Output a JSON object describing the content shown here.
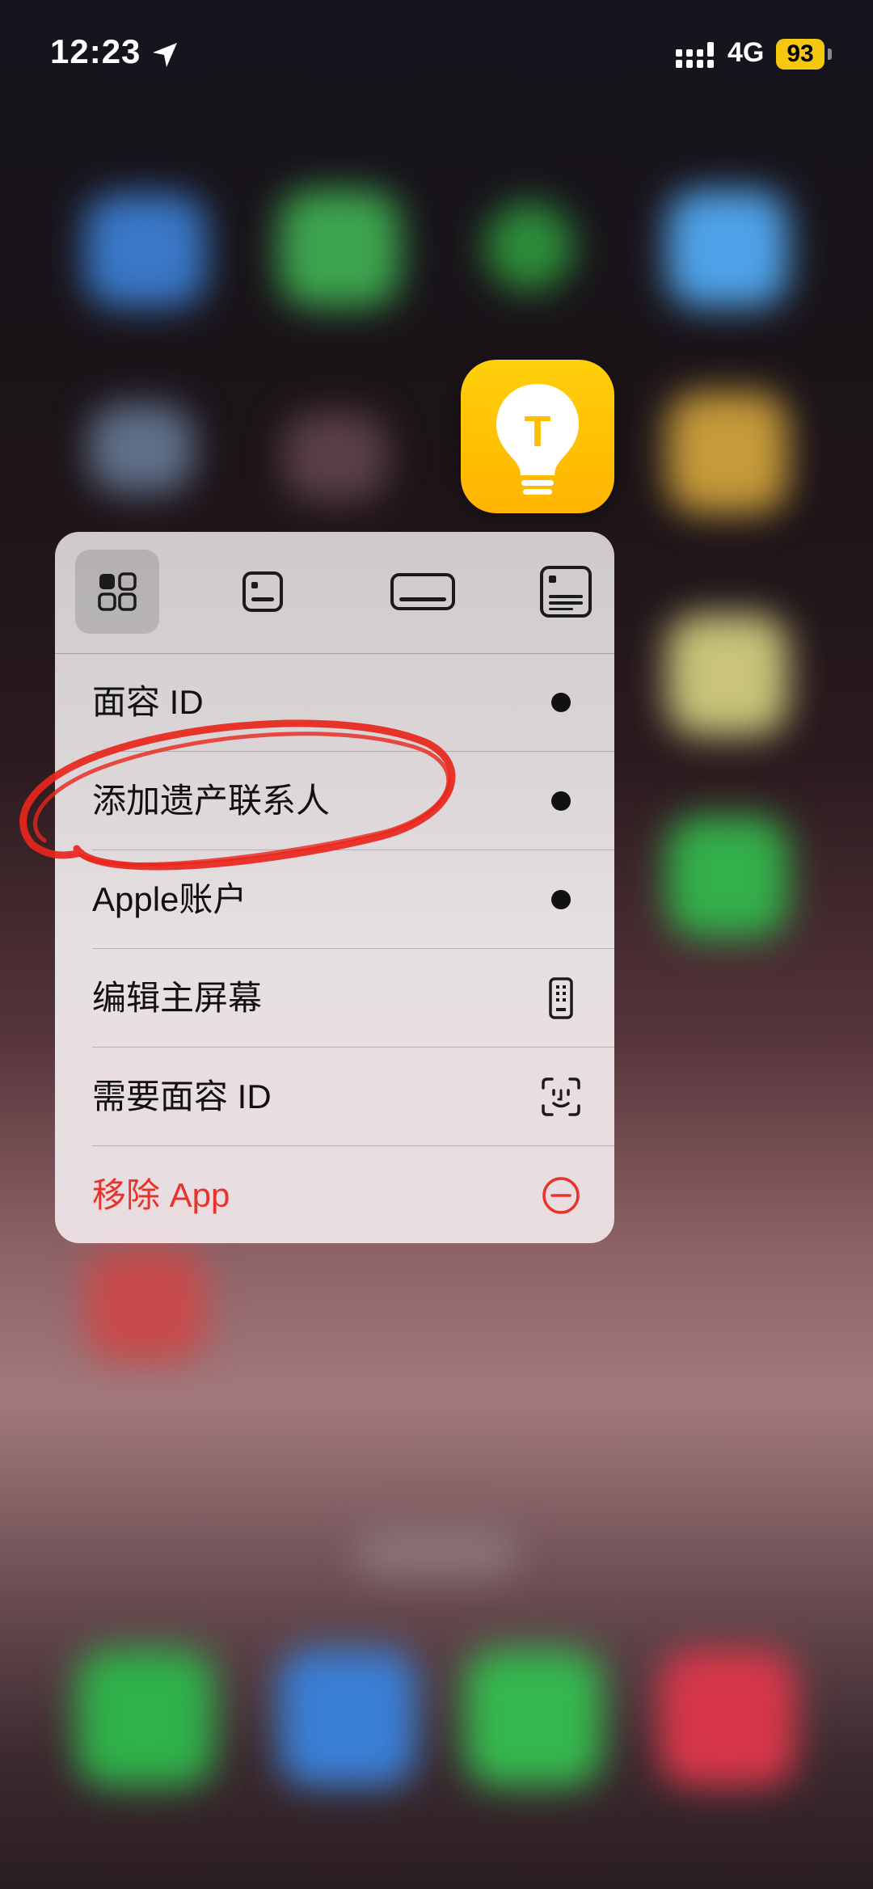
{
  "status_bar": {
    "time": "12:23",
    "network": "4G",
    "battery": "93"
  },
  "app_icon": {
    "glyph": "T",
    "color": "#FFC107"
  },
  "widget_sizes": [
    "grid-icon",
    "small-widget-icon",
    "medium-widget-icon",
    "large-widget-icon"
  ],
  "menu": {
    "items": [
      {
        "label": "面容 ID",
        "icon": "dot-icon"
      },
      {
        "label": "添加遗产联系人",
        "icon": "dot-icon"
      },
      {
        "label": "Apple账户",
        "icon": "dot-icon"
      },
      {
        "label": "编辑主屏幕",
        "icon": "phone-grid-icon"
      },
      {
        "label": "需要面容 ID",
        "icon": "face-id-icon"
      },
      {
        "label": "移除 App",
        "icon": "minus-circle-icon",
        "color": "#E8322A"
      }
    ]
  },
  "annotation": {
    "type": "red-hand-drawn-circle",
    "color": "#E8261C",
    "target": "添加遗产联系人"
  }
}
